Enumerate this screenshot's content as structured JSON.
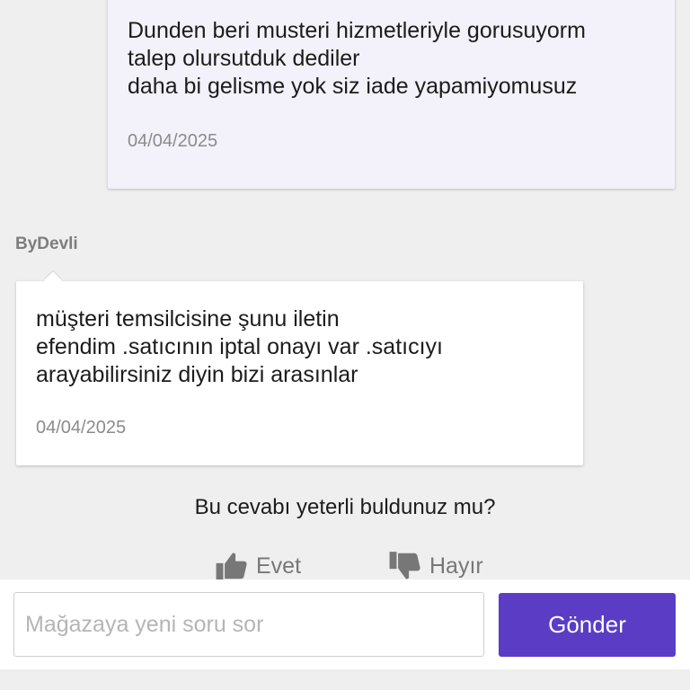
{
  "user_message": {
    "text": "Dunden beri musteri hizmetleriyle gorusuyorm\ntalep olursutduk dediler\ndaha bi gelisme yok siz iade yapamiyomusuz",
    "date": "04/04/2025"
  },
  "seller_message": {
    "sender": "ByDevli",
    "text": "müşteri temsilcisine şunu iletin\nefendim .satıcının iptal onayı var .satıcıyı\narayabilirsiniz diyin bizi arasınlar",
    "date": "04/04/2025"
  },
  "feedback": {
    "question": "Bu cevabı yeterli buldunuz mu?",
    "yes_label": "Evet",
    "no_label": "Hayır",
    "yes_icon": "thumbs-up-icon",
    "no_icon": "thumbs-down-icon"
  },
  "composer": {
    "placeholder": "Mağazaya yeni soru sor",
    "value": "",
    "send_label": "Gönder",
    "send_color": "#5b3cc4"
  }
}
